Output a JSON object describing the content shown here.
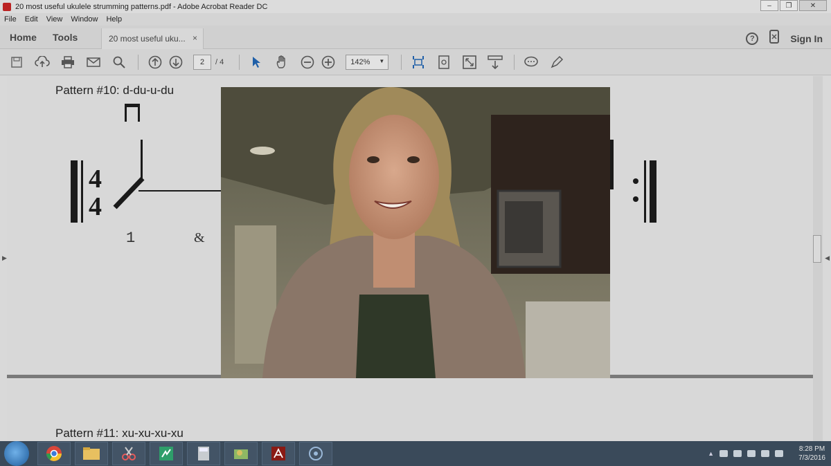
{
  "window": {
    "title": "20 most useful ukulele strumming patterns.pdf - Adobe Acrobat Reader DC",
    "minimize": "–",
    "restore": "❐",
    "close": "✕"
  },
  "menu": [
    "File",
    "Edit",
    "View",
    "Window",
    "Help"
  ],
  "tabs": {
    "home": "Home",
    "tools": "Tools",
    "document": "20 most useful uku...",
    "close": "×",
    "help": "?",
    "sign_in": "Sign In"
  },
  "toolbar": {
    "page_current": "2",
    "page_total": "/ 4",
    "zoom": "142%",
    "icons": [
      "save-icon",
      "cloud-upload-icon",
      "print-icon",
      "email-icon",
      "search-icon",
      "page-up-icon",
      "page-down-icon",
      "select-arrow-icon",
      "hand-icon",
      "zoom-out-icon",
      "zoom-in-icon",
      "fit-page-icon",
      "rotate-icon",
      "fullscreen-icon",
      "read-mode-icon",
      "comment-icon",
      "highlight-icon"
    ]
  },
  "document": {
    "pattern10_title": "Pattern #10: d-du-u-du",
    "beat_1": "1",
    "beat_and": "&",
    "time_sig_top": "4",
    "time_sig_bottom": "4",
    "pattern11_title": "Pattern #11: xu-xu-xu-xu"
  },
  "taskbar": {
    "apps": [
      "chrome-icon",
      "file-explorer-icon",
      "snipping-tool-icon",
      "app-green-icon",
      "calculator-icon",
      "app-folder-icon",
      "acrobat-icon",
      "media-icon"
    ],
    "time": "8:28 PM",
    "date": "7/3/2016"
  }
}
